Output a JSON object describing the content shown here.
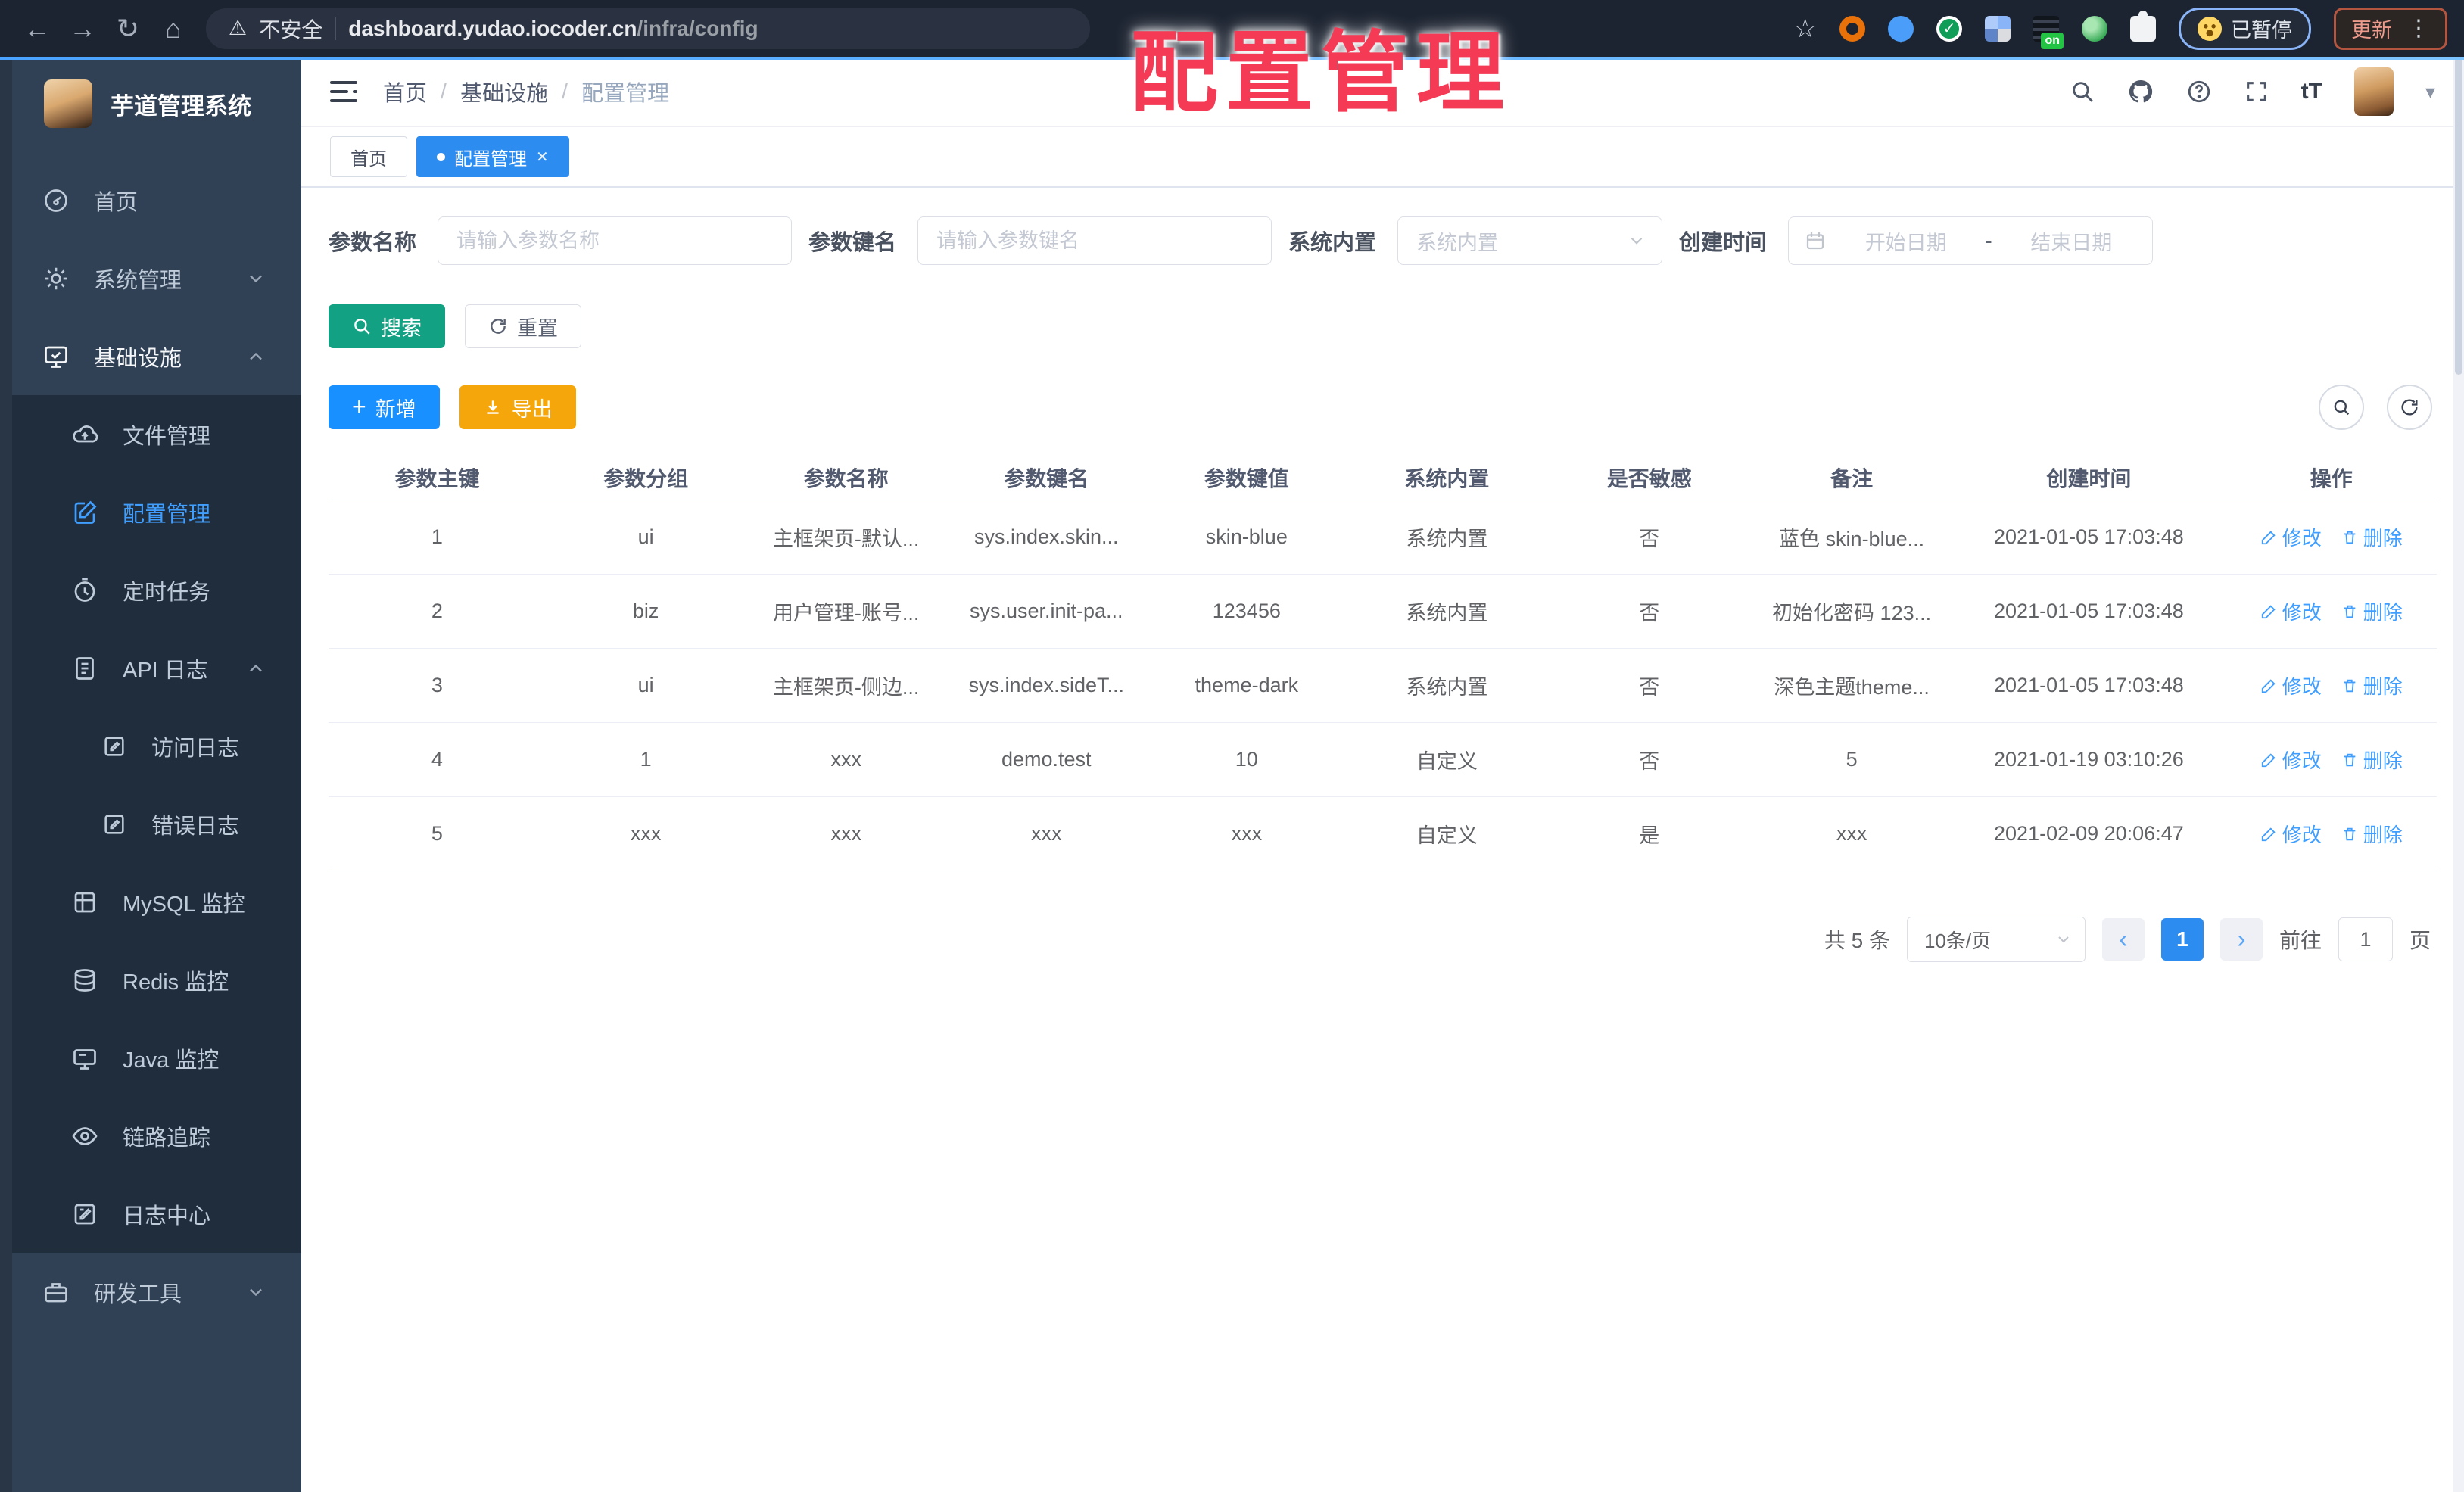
{
  "overlay_title": "配置管理",
  "browser": {
    "back_icon": "←",
    "forward_icon": "→",
    "reload_icon": "↻",
    "home_icon": "⌂",
    "warning_icon": "⚠",
    "not_secure": "不安全",
    "url_host": "dashboard.yudao.iocoder.cn",
    "url_path": "/infra/config",
    "star_icon": "☆",
    "paused_label": "已暂停",
    "update_label": "更新",
    "kebab_icon": "⋮"
  },
  "sidebar": {
    "title": "芋道管理系统",
    "items": [
      {
        "label": "首页"
      },
      {
        "label": "系统管理"
      },
      {
        "label": "基础设施"
      },
      {
        "label": "文件管理"
      },
      {
        "label": "配置管理"
      },
      {
        "label": "定时任务"
      },
      {
        "label": "API 日志"
      },
      {
        "label": "访问日志"
      },
      {
        "label": "错误日志"
      },
      {
        "label": "MySQL 监控"
      },
      {
        "label": "Redis 监控"
      },
      {
        "label": "Java 监控"
      },
      {
        "label": "链路追踪"
      },
      {
        "label": "日志中心"
      },
      {
        "label": "研发工具"
      }
    ]
  },
  "header": {
    "breadcrumb": [
      "首页",
      "基础设施",
      "配置管理"
    ],
    "separator": "/",
    "font_icon": "tT",
    "caret_icon": "▾"
  },
  "tabs": [
    {
      "label": "首页"
    },
    {
      "label": "配置管理",
      "close_icon": "✕"
    }
  ],
  "filters": {
    "name_label": "参数名称",
    "name_placeholder": "请输入参数名称",
    "key_label": "参数键名",
    "key_placeholder": "请输入参数键名",
    "builtin_label": "系统内置",
    "builtin_placeholder": "系统内置",
    "time_label": "创建时间",
    "start_placeholder": "开始日期",
    "range_separator": "-",
    "end_placeholder": "结束日期"
  },
  "toolbar": {
    "search": "搜索",
    "reset": "重置",
    "add": "新增",
    "add_icon": "+",
    "export": "导出"
  },
  "table": {
    "columns": [
      "参数主键",
      "参数分组",
      "参数名称",
      "参数键名",
      "参数键值",
      "系统内置",
      "是否敏感",
      "备注",
      "创建时间",
      "操作"
    ],
    "edit_label": "修改",
    "delete_label": "删除",
    "rows": [
      {
        "id": "1",
        "group": "ui",
        "name": "主框架页-默认...",
        "key": "sys.index.skin...",
        "value": "skin-blue",
        "builtin": "系统内置",
        "sensitive": "否",
        "remark": "蓝色 skin-blue...",
        "created": "2021-01-05 17:03:48"
      },
      {
        "id": "2",
        "group": "biz",
        "name": "用户管理-账号...",
        "key": "sys.user.init-pa...",
        "value": "123456",
        "builtin": "系统内置",
        "sensitive": "否",
        "remark": "初始化密码 123...",
        "created": "2021-01-05 17:03:48"
      },
      {
        "id": "3",
        "group": "ui",
        "name": "主框架页-侧边...",
        "key": "sys.index.sideT...",
        "value": "theme-dark",
        "builtin": "系统内置",
        "sensitive": "否",
        "remark": "深色主题theme...",
        "created": "2021-01-05 17:03:48"
      },
      {
        "id": "4",
        "group": "1",
        "name": "xxx",
        "key": "demo.test",
        "value": "10",
        "builtin": "自定义",
        "sensitive": "否",
        "remark": "5",
        "created": "2021-01-19 03:10:26"
      },
      {
        "id": "5",
        "group": "xxx",
        "name": "xxx",
        "key": "xxx",
        "value": "xxx",
        "builtin": "自定义",
        "sensitive": "是",
        "remark": "xxx",
        "created": "2021-02-09 20:06:47"
      }
    ]
  },
  "pagination": {
    "total": "共 5 条",
    "page_size": "10条/页",
    "prev_icon": "‹",
    "page": "1",
    "next_icon": "›",
    "goto_label": "前往",
    "goto_value": "1",
    "page_unit": "页"
  },
  "colors": {
    "accent_blue": "#2d8cf0",
    "link_blue": "#409eff",
    "teal": "#12a182",
    "orange": "#f5a60a",
    "overlay_red": "#f43a55"
  }
}
